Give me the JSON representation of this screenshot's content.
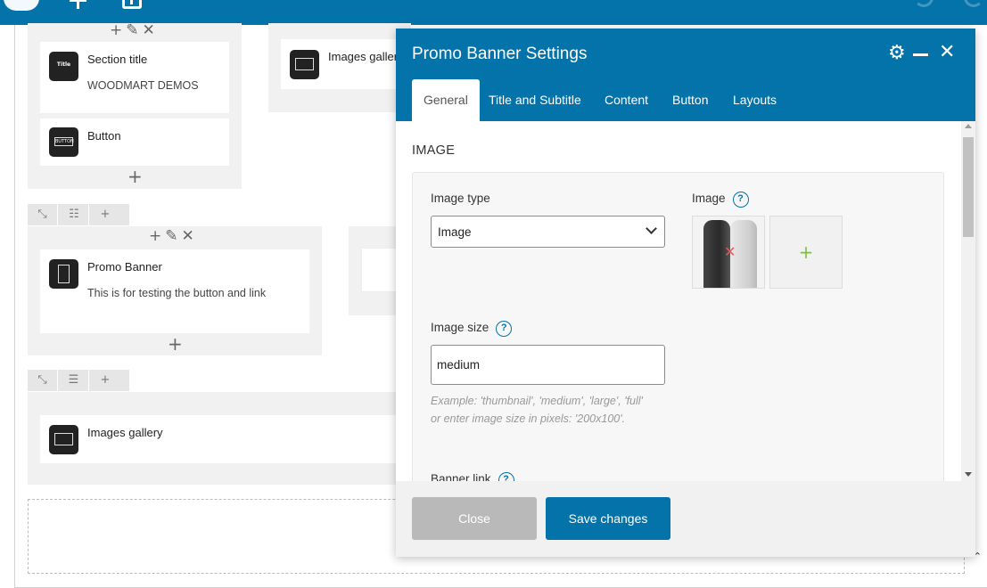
{
  "builder": {
    "elements": {
      "section_title": {
        "title": "Section title",
        "subtitle": "WOODMART DEMOS",
        "icon_text": "Title"
      },
      "button": {
        "title": "Button",
        "icon_text": "BUTTON"
      },
      "images_gallery_top": {
        "title": "Images galler"
      },
      "promo_banner": {
        "title": "Promo Banner",
        "subtitle": "This is for testing the button and link"
      },
      "images_gallery": {
        "title": "Images gallery"
      }
    },
    "controls": {
      "add": "+",
      "edit": "✎",
      "delete": "✕"
    }
  },
  "modal": {
    "title": "Promo Banner Settings",
    "tabs": [
      {
        "label": "General",
        "active": true
      },
      {
        "label": "Title and Subtitle"
      },
      {
        "label": "Content"
      },
      {
        "label": "Button"
      },
      {
        "label": "Layouts"
      }
    ],
    "section_heading": "IMAGE",
    "fields": {
      "image_type": {
        "label": "Image type",
        "value": "Image"
      },
      "image": {
        "label": "Image",
        "help": "?",
        "remove_symbol": "✕",
        "add_symbol": "+"
      },
      "image_size": {
        "label": "Image size",
        "help": "?",
        "value": "medium",
        "hint": "Example: 'thumbnail', 'medium', 'large', 'full' or enter image size in pixels: '200x100'."
      },
      "banner_link": {
        "label": "Banner link",
        "help": "?"
      }
    },
    "footer": {
      "close_label": "Close",
      "save_label": "Save changes"
    }
  },
  "colors": {
    "brand": "#0473aa",
    "add_green": "#7cc53a"
  }
}
